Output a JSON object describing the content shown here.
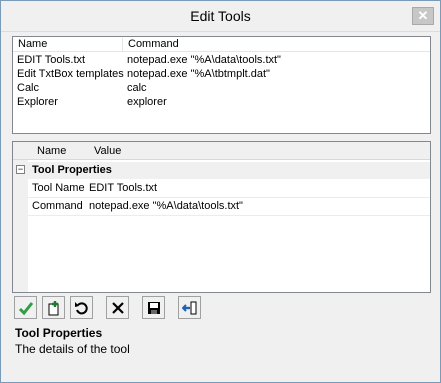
{
  "window": {
    "title": "Edit Tools",
    "close_glyph": "✕"
  },
  "tools_list": {
    "headers": {
      "name": "Name",
      "command": "Command"
    },
    "rows": [
      {
        "name": "EDIT Tools.txt",
        "command": "notepad.exe \"%A\\data\\tools.txt\""
      },
      {
        "name": "Edit TxtBox templates",
        "command": "notepad.exe \"%A\\tbtmplt.dat\""
      },
      {
        "name": "Calc",
        "command": "calc"
      },
      {
        "name": "Explorer",
        "command": "explorer"
      }
    ]
  },
  "property_grid": {
    "headers": {
      "name": "Name",
      "value": "Value"
    },
    "category": {
      "label": "Tool Properties",
      "toggle": "−"
    },
    "rows": [
      {
        "name": "Tool Name",
        "value": "EDIT Tools.txt"
      },
      {
        "name": "Command",
        "value": "notepad.exe \"%A\\data\\tools.txt\""
      }
    ]
  },
  "toolbar": {
    "buttons": [
      {
        "icon": "checkmark-icon",
        "color": "#2ea043"
      },
      {
        "icon": "add-document-icon",
        "color": "#1b7d2c"
      },
      {
        "icon": "undo-icon",
        "color": "#000000"
      },
      {
        "icon": "delete-x-icon",
        "color": "#000000"
      },
      {
        "icon": "save-floppy-icon",
        "color": "#000000"
      },
      {
        "icon": "exit-door-icon",
        "color": "#1f5fb8"
      }
    ]
  },
  "help_panel": {
    "title": "Tool Properties",
    "description": "The details of the tool"
  }
}
